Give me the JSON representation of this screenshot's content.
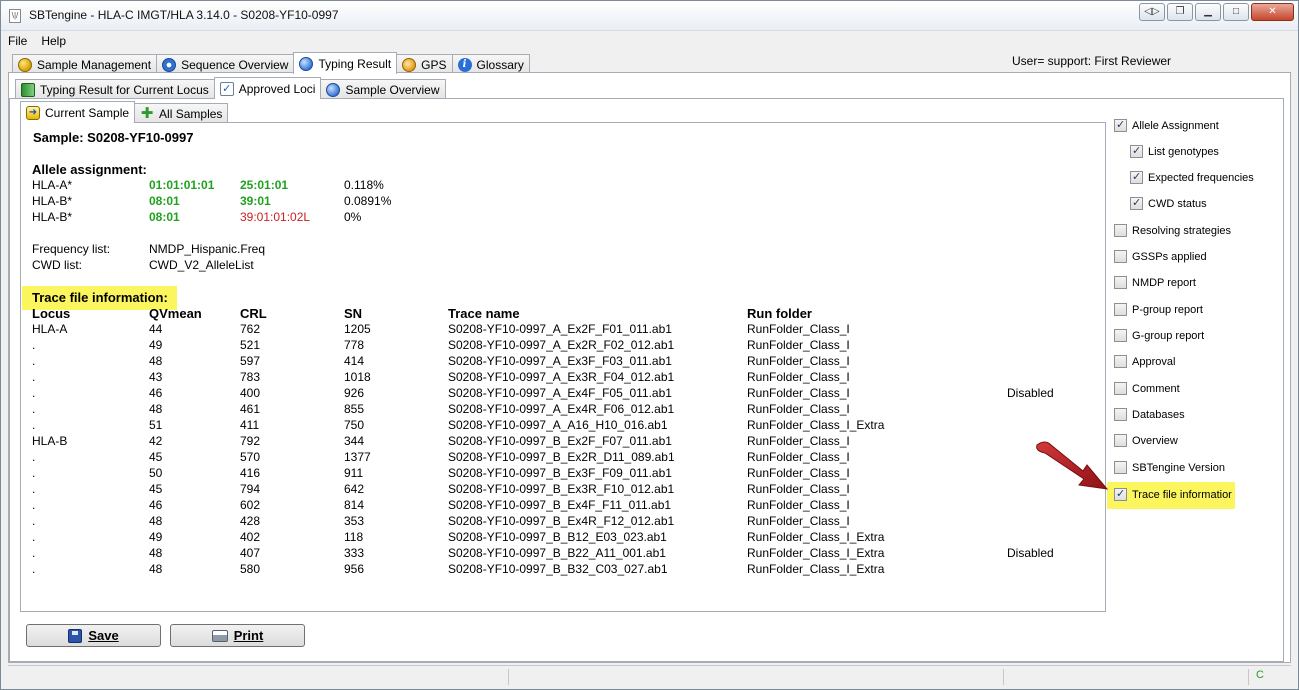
{
  "window": {
    "title": "SBTengine - HLA-C IMGT/HLA 3.14.0 - S0208-YF10-0997",
    "app_icon": "app-icon"
  },
  "menu": {
    "items": [
      "File",
      "Help"
    ]
  },
  "main_tabs": [
    {
      "label": "Sample Management",
      "icon": "globe-icon"
    },
    {
      "label": "Sequence Overview",
      "icon": "gear-icon"
    },
    {
      "label": "Typing Result",
      "icon": "blue-circle-icon",
      "active": true
    },
    {
      "label": "GPS",
      "icon": "compass-icon"
    },
    {
      "label": "Glossary",
      "icon": "info-icon"
    }
  ],
  "user_label": "User= support: First Reviewer",
  "sub_tabs": [
    {
      "label": "Typing Result for Current Locus",
      "icon": "book-icon"
    },
    {
      "label": "Approved Loci",
      "icon": "checklist-icon",
      "active": true
    },
    {
      "label": "Sample Overview",
      "icon": "blue-circle-icon"
    }
  ],
  "inner_tabs": [
    {
      "label": "Current Sample",
      "icon": "arrow-icon",
      "active": true
    },
    {
      "label": "All Samples",
      "icon": "plus-icon"
    }
  ],
  "report": {
    "sample_label": "Sample:  S0208-YF10-0997",
    "allele_heading": "Allele assignment:",
    "alleles": [
      {
        "locus": "HLA-A*",
        "a1": "01:01:01:01",
        "a2": "25:01:01",
        "freq": "0.118%",
        "a2_status": "green"
      },
      {
        "locus": "HLA-B*",
        "a1": "08:01",
        "a2": "39:01",
        "freq": "0.0891%",
        "a2_status": "green"
      },
      {
        "locus": "HLA-B*",
        "a1": "08:01",
        "a2": "39:01:01:02L",
        "freq": "0%",
        "a2_status": "red"
      }
    ],
    "frequency_list_label": "Frequency list:",
    "frequency_list_value": "NMDP_Hispanic.Freq",
    "cwd_list_label": "CWD list:",
    "cwd_list_value": "CWD_V2_AlleleList",
    "trace_heading": "Trace file information:",
    "trace_columns": [
      "Locus",
      "QVmean",
      "CRL",
      "SN",
      "Trace name",
      "Run folder"
    ],
    "trace_rows": [
      {
        "locus": "HLA-A",
        "qv": "44",
        "crl": "762",
        "sn": "1205",
        "trace": "S0208-YF10-0997_A_Ex2F_F01_011.ab1",
        "run": "RunFolder_Class_I",
        "status": ""
      },
      {
        "locus": ".",
        "qv": "49",
        "crl": "521",
        "sn": "778",
        "trace": "S0208-YF10-0997_A_Ex2R_F02_012.ab1",
        "run": "RunFolder_Class_I",
        "status": ""
      },
      {
        "locus": ".",
        "qv": "48",
        "crl": "597",
        "sn": "414",
        "trace": "S0208-YF10-0997_A_Ex3F_F03_011.ab1",
        "run": "RunFolder_Class_I",
        "status": ""
      },
      {
        "locus": ".",
        "qv": "43",
        "crl": "783",
        "sn": "1018",
        "trace": "S0208-YF10-0997_A_Ex3R_F04_012.ab1",
        "run": "RunFolder_Class_I",
        "status": ""
      },
      {
        "locus": ".",
        "qv": "46",
        "crl": "400",
        "sn": "926",
        "trace": "S0208-YF10-0997_A_Ex4F_F05_011.ab1",
        "run": "RunFolder_Class_I",
        "status": "Disabled"
      },
      {
        "locus": ".",
        "qv": "48",
        "crl": "461",
        "sn": "855",
        "trace": "S0208-YF10-0997_A_Ex4R_F06_012.ab1",
        "run": "RunFolder_Class_I",
        "status": ""
      },
      {
        "locus": ".",
        "qv": "51",
        "crl": "411",
        "sn": "750",
        "trace": "S0208-YF10-0997_A_A16_H10_016.ab1",
        "run": "RunFolder_Class_I_Extra",
        "status": ""
      },
      {
        "locus": "HLA-B",
        "qv": "42",
        "crl": "792",
        "sn": "344",
        "trace": "S0208-YF10-0997_B_Ex2F_F07_011.ab1",
        "run": "RunFolder_Class_I",
        "status": ""
      },
      {
        "locus": ".",
        "qv": "45",
        "crl": "570",
        "sn": "1377",
        "trace": "S0208-YF10-0997_B_Ex2R_D11_089.ab1",
        "run": "RunFolder_Class_I",
        "status": ""
      },
      {
        "locus": ".",
        "qv": "50",
        "crl": "416",
        "sn": "911",
        "trace": "S0208-YF10-0997_B_Ex3F_F09_011.ab1",
        "run": "RunFolder_Class_I",
        "status": ""
      },
      {
        "locus": ".",
        "qv": "45",
        "crl": "794",
        "sn": "642",
        "trace": "S0208-YF10-0997_B_Ex3R_F10_012.ab1",
        "run": "RunFolder_Class_I",
        "status": ""
      },
      {
        "locus": ".",
        "qv": "46",
        "crl": "602",
        "sn": "814",
        "trace": "S0208-YF10-0997_B_Ex4F_F11_011.ab1",
        "run": "RunFolder_Class_I",
        "status": ""
      },
      {
        "locus": ".",
        "qv": "48",
        "crl": "428",
        "sn": "353",
        "trace": "S0208-YF10-0997_B_Ex4R_F12_012.ab1",
        "run": "RunFolder_Class_I",
        "status": ""
      },
      {
        "locus": ".",
        "qv": "49",
        "crl": "402",
        "sn": "118",
        "trace": "S0208-YF10-0997_B_B12_E03_023.ab1",
        "run": "RunFolder_Class_I_Extra",
        "status": ""
      },
      {
        "locus": ".",
        "qv": "48",
        "crl": "407",
        "sn": "333",
        "trace": "S0208-YF10-0997_B_B22_A11_001.ab1",
        "run": "RunFolder_Class_I_Extra",
        "status": "Disabled"
      },
      {
        "locus": ".",
        "qv": "48",
        "crl": "580",
        "sn": "956",
        "trace": "S0208-YF10-0997_B_B32_C03_027.ab1",
        "run": "RunFolder_Class_I_Extra",
        "status": ""
      }
    ]
  },
  "options": [
    {
      "label": "Allele Assignment",
      "checked": true,
      "indent": 0
    },
    {
      "label": "List genotypes",
      "checked": true,
      "indent": 1
    },
    {
      "label": "Expected frequencies",
      "checked": true,
      "indent": 1
    },
    {
      "label": "CWD status",
      "checked": true,
      "indent": 1
    },
    {
      "label": "Resolving strategies",
      "checked": false,
      "indent": 0
    },
    {
      "label": "GSSPs applied",
      "checked": false,
      "indent": 0
    },
    {
      "label": "NMDP report",
      "checked": false,
      "indent": 0
    },
    {
      "label": "P-group report",
      "checked": false,
      "indent": 0
    },
    {
      "label": "G-group report",
      "checked": false,
      "indent": 0
    },
    {
      "label": "Approval",
      "checked": false,
      "indent": 0
    },
    {
      "label": "Comment",
      "checked": false,
      "indent": 0
    },
    {
      "label": "Databases",
      "checked": false,
      "indent": 0
    },
    {
      "label": "Overview",
      "checked": false,
      "indent": 0
    },
    {
      "label": "SBTengine Version",
      "checked": false,
      "indent": 0
    },
    {
      "label": "Trace file informatior",
      "checked": true,
      "indent": 0,
      "highlighted": true
    }
  ],
  "buttons": {
    "save": "Save",
    "print": "Print"
  },
  "status_bar": {
    "indicator": "C"
  },
  "colors": {
    "allele_green": "#1fa31f",
    "allele_red": "#cc1f1f",
    "highlight_yellow": "#fbf65d",
    "arrow_red": "#b3171f"
  }
}
